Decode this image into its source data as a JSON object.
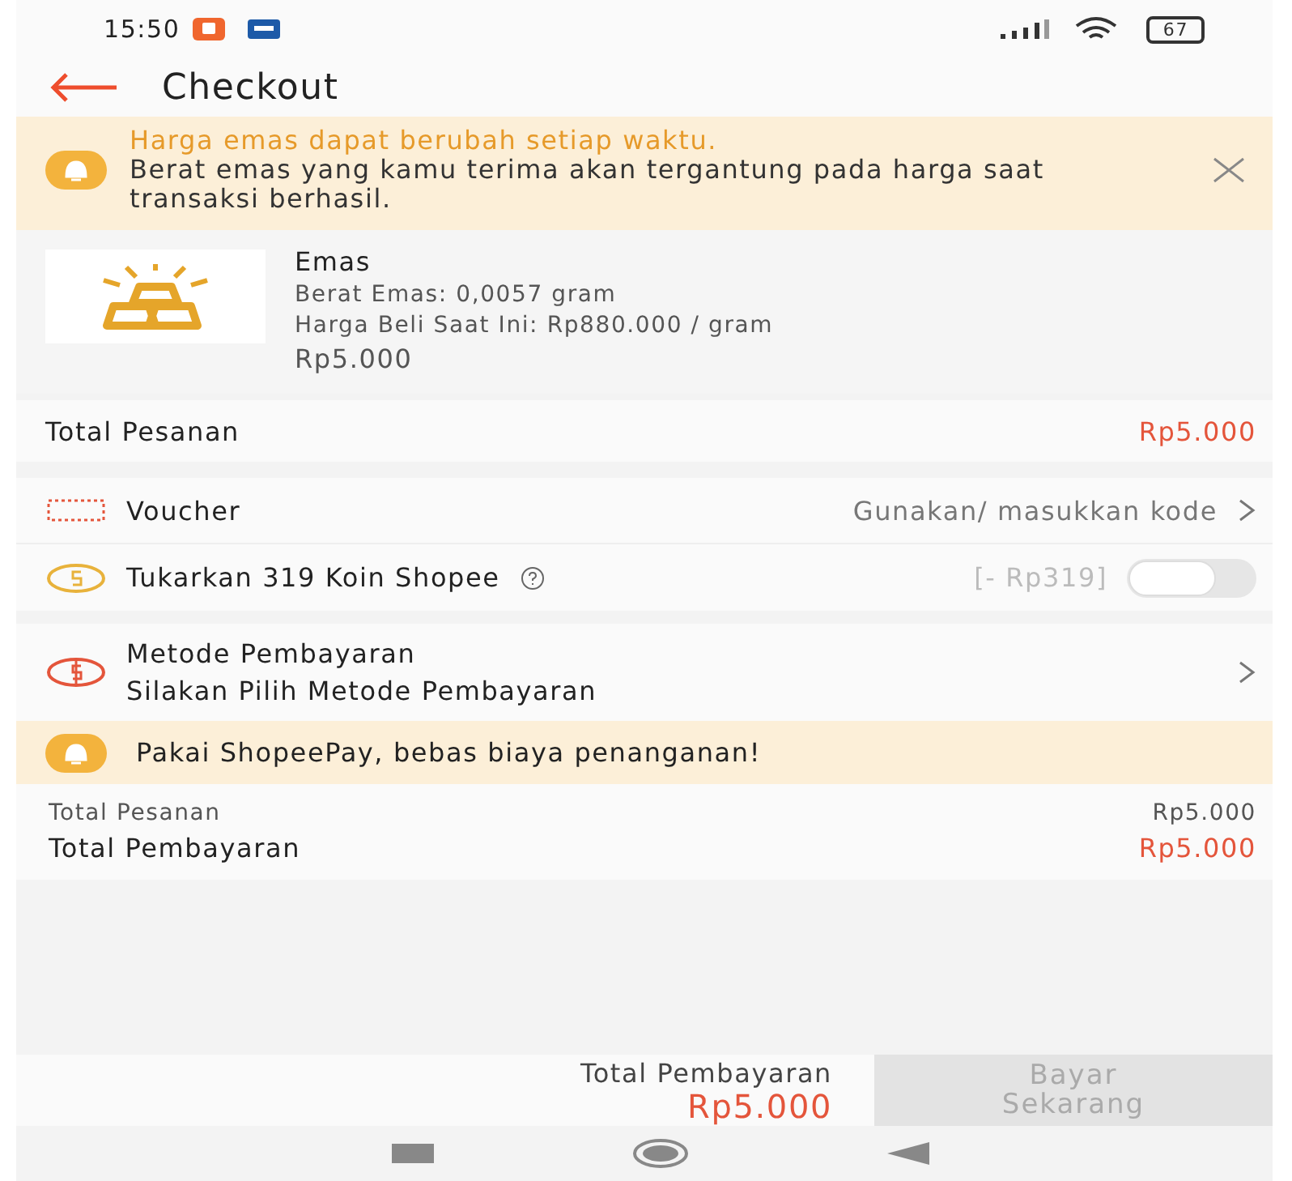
{
  "status_bar": {
    "time": "15:50",
    "battery": "67"
  },
  "header": {
    "title": "Checkout"
  },
  "notice": {
    "headline": "Harga emas dapat berubah setiap waktu.",
    "body": "Berat emas yang kamu terima akan tergantung pada harga saat transaksi berhasil."
  },
  "product": {
    "name": "Emas",
    "weight": "Berat Emas: 0,0057 gram",
    "price_per_gram": "Harga Beli Saat Ini: Rp880.000 / gram",
    "price": "Rp5.000"
  },
  "order_total": {
    "label": "Total Pesanan",
    "value": "Rp5.000"
  },
  "voucher": {
    "label": "Voucher",
    "action": "Gunakan/ masukkan kode"
  },
  "coins": {
    "label": "Tukarkan 319 Koin Shopee",
    "amount": "[- Rp319]",
    "on": false
  },
  "payment_method": {
    "label": "Metode Pembayaran",
    "hint": "Silakan Pilih Metode Pembayaran"
  },
  "promo": {
    "text": "Pakai ShopeePay, bebas biaya penanganan!"
  },
  "summary": [
    {
      "label": "Total Pesanan",
      "value": "Rp5.000",
      "kind": "minor"
    },
    {
      "label": "Total Pembayaran",
      "value": "Rp5.000",
      "kind": "major"
    }
  ],
  "bottom_bar": {
    "label": "Total Pembayaran",
    "value": "Rp5.000",
    "button": "Bayar Sekarang",
    "disabled": true
  }
}
